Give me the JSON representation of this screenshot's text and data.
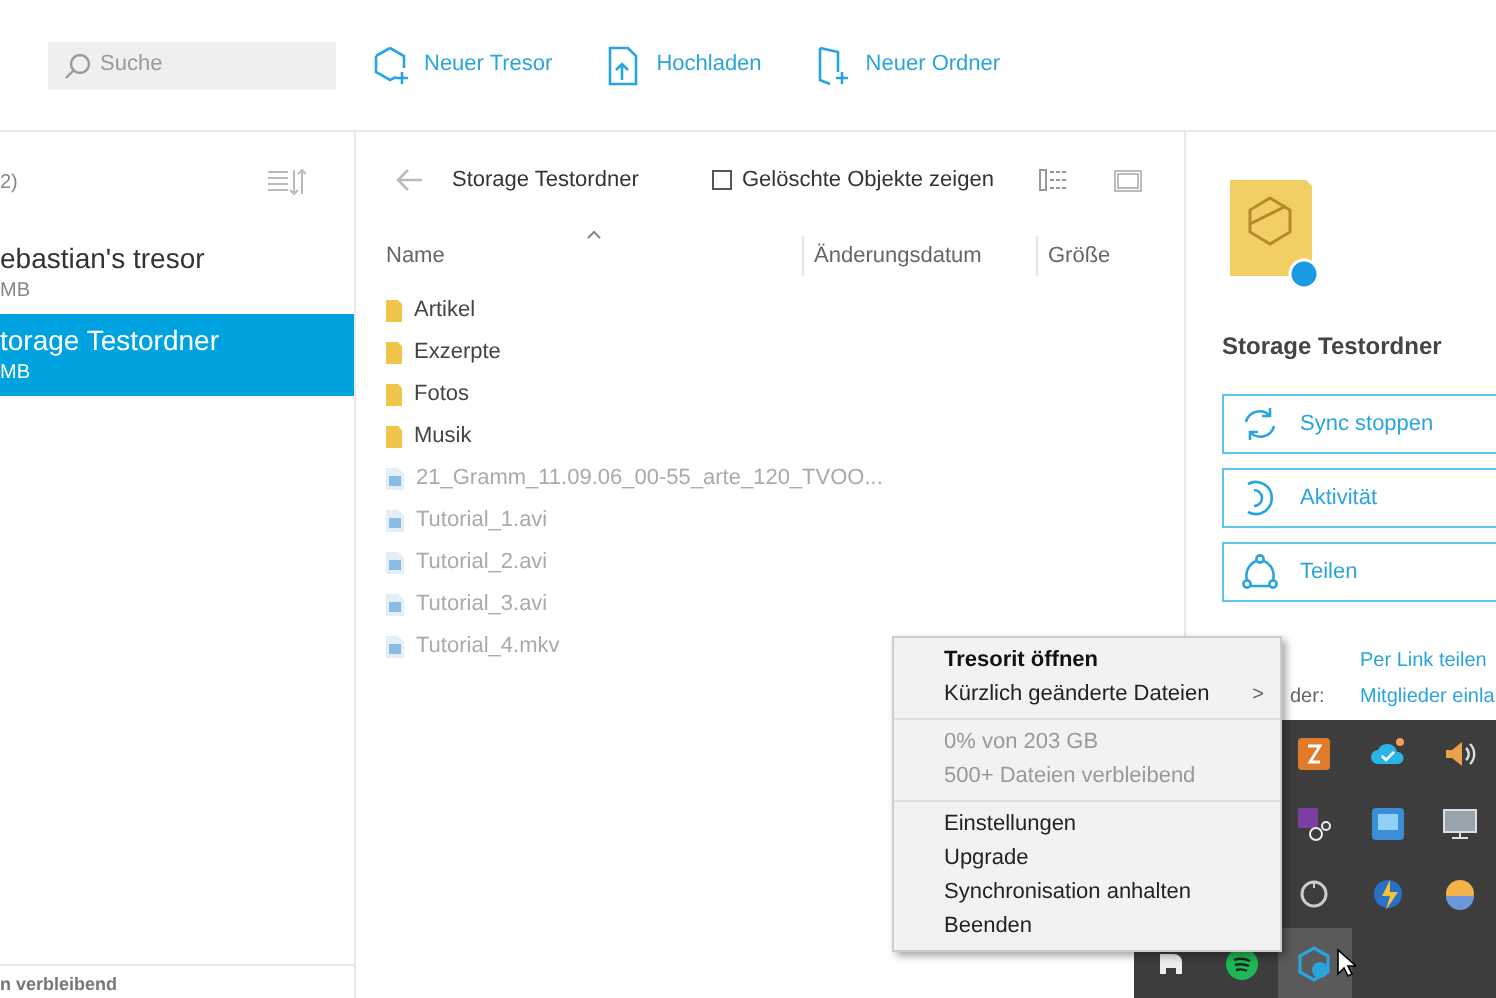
{
  "toolbar": {
    "search": {
      "placeholder": "Suche"
    },
    "actions": [
      {
        "kind": "vault",
        "label": "Neuer Tresor"
      },
      {
        "kind": "upload",
        "label": "Hochladen"
      },
      {
        "kind": "folder",
        "label": "Neuer Ordner"
      }
    ]
  },
  "sidebar": {
    "header": "2)",
    "items": [
      {
        "name": "ebastian's tresor",
        "size": "MB",
        "selected": false
      },
      {
        "name": "torage Testordner",
        "size": "MB",
        "selected": true
      }
    ],
    "footer": "n verbleibend"
  },
  "files": {
    "title": "Storage Testordner",
    "show_deleted": {
      "label": "Gelöschte Objekte zeigen",
      "checked": false
    },
    "columns": [
      "Name",
      "Änderungsdatum",
      "Größe"
    ],
    "items": [
      {
        "kind": "folder",
        "name": "Artikel"
      },
      {
        "kind": "folder",
        "name": "Exzerpte"
      },
      {
        "kind": "folder",
        "name": "Fotos"
      },
      {
        "kind": "folder",
        "name": "Musik"
      },
      {
        "kind": "file",
        "name": "21_Gramm_11.09.06_00-55_arte_120_TVOO..."
      },
      {
        "kind": "file",
        "name": "Tutorial_1.avi"
      },
      {
        "kind": "file",
        "name": "Tutorial_2.avi"
      },
      {
        "kind": "file",
        "name": "Tutorial_3.avi"
      },
      {
        "kind": "file",
        "name": "Tutorial_4.mkv"
      }
    ]
  },
  "details": {
    "title": "Storage Testordner",
    "actions": [
      {
        "kind": "sync",
        "label": "Sync stoppen"
      },
      {
        "kind": "activity",
        "label": "Aktivität"
      },
      {
        "kind": "share",
        "label": "Teilen"
      }
    ],
    "share_rows": [
      {
        "link": "Per Link teilen"
      },
      {
        "label": "der:",
        "link": "Mitglieder einla"
      }
    ]
  },
  "context_menu": {
    "groups": [
      [
        {
          "kind": "bold",
          "label": "Tresorit öffnen"
        },
        {
          "kind": "submenu",
          "label": "Kürzlich geänderte Dateien",
          "arrow": ">"
        }
      ],
      [
        {
          "kind": "info",
          "label": "0% von 203 GB"
        },
        {
          "kind": "info",
          "label": "500+ Dateien verbleibend"
        }
      ],
      [
        {
          "kind": "normal",
          "label": "Einstellungen"
        },
        {
          "kind": "normal",
          "label": "Upgrade"
        },
        {
          "kind": "normal",
          "label": "Synchronisation anhalten"
        },
        {
          "kind": "normal",
          "label": "Beenden"
        }
      ]
    ]
  },
  "tray_icons": [
    {
      "selected": false
    },
    {
      "selected": false
    },
    {
      "selected": false
    },
    {
      "selected": false
    },
    {
      "selected": false
    },
    {
      "selected": false
    },
    {
      "selected": false
    },
    {
      "selected": false
    },
    {
      "selected": false
    },
    {
      "selected": false
    },
    {
      "selected": false
    },
    {
      "selected": true
    }
  ]
}
